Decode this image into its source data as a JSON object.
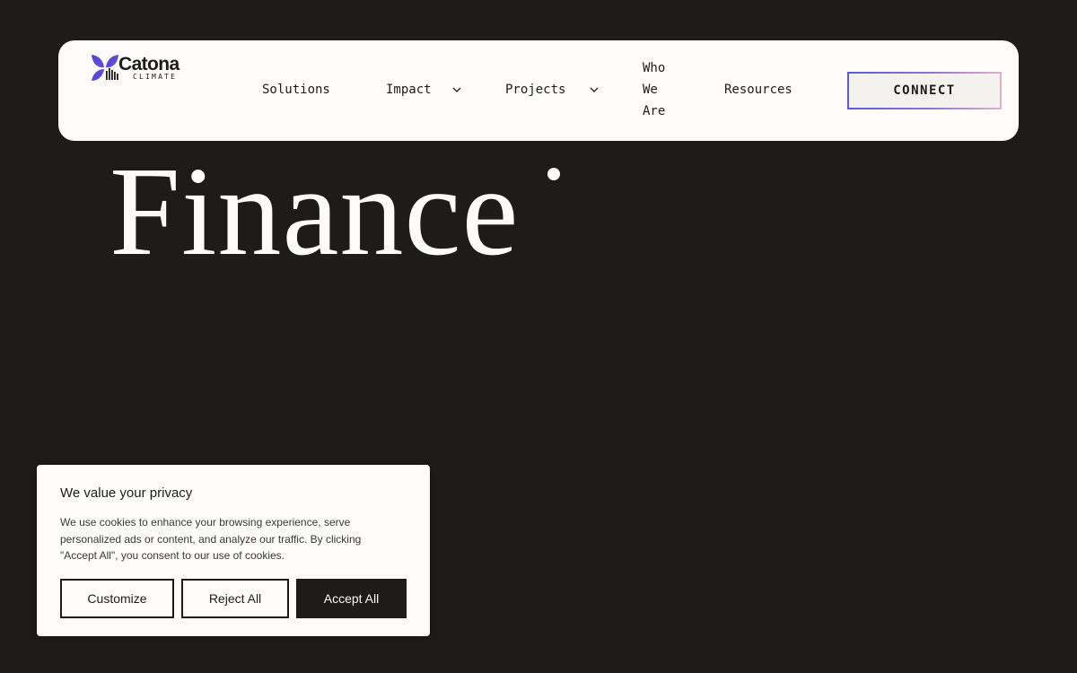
{
  "brand": {
    "name": "Catona",
    "tagline": "CLIMATE",
    "logo_icon": "butterfly-leaf-icon",
    "colors": {
      "dark": "#1e1c1b",
      "light": "#fdfcfa",
      "accent_blue": "#4a47d8",
      "accent_purple": "#7a5ad6",
      "accent_pink": "#dfb2c6"
    }
  },
  "nav": {
    "items": [
      {
        "label": "Solutions",
        "has_dropdown": false
      },
      {
        "label": "Impact",
        "has_dropdown": true
      },
      {
        "label": "Projects",
        "has_dropdown": true
      },
      {
        "label": "Who We Are",
        "has_dropdown": false
      },
      {
        "label": "Resources",
        "has_dropdown": false
      }
    ],
    "cta_label": "CONNECT"
  },
  "hero": {
    "title": "Finance"
  },
  "cookie_banner": {
    "title": "We value your privacy",
    "text": "We use cookies to enhance your browsing experience, serve personalized ads or content, and analyze our traffic. By clicking \"Accept All\", you consent to our use of cookies.",
    "buttons": {
      "customize": "Customize",
      "reject": "Reject All",
      "accept": "Accept All"
    }
  }
}
